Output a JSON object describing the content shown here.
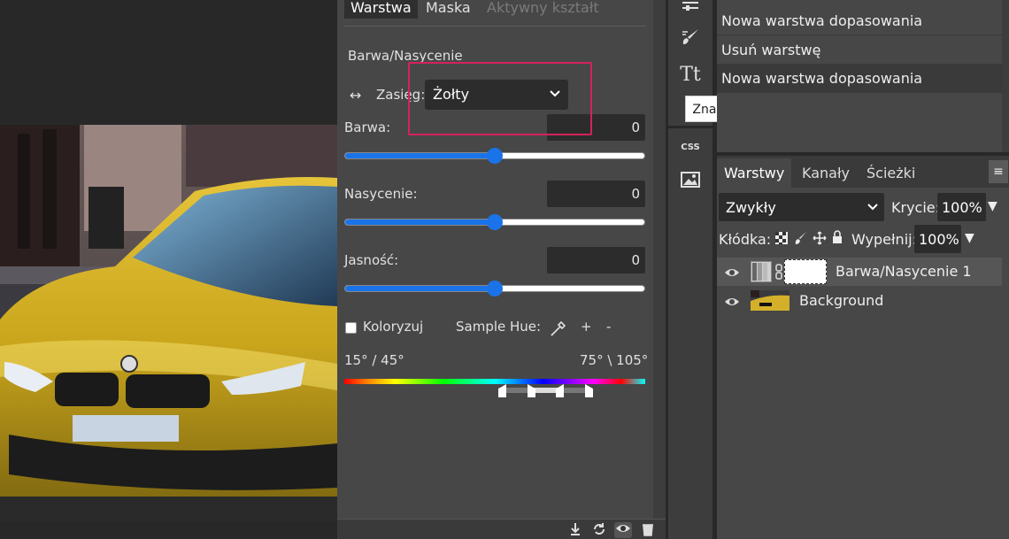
{
  "properties": {
    "tabs": [
      {
        "label": "Warstwa",
        "state": "active"
      },
      {
        "label": "Maska",
        "state": "normal"
      },
      {
        "label": "Aktywny kształt",
        "state": "disabled"
      }
    ],
    "section_title": "Barwa/Nasycenie",
    "range_label": "Zasięg:",
    "range_value": "Żołty",
    "hue": {
      "label": "Barwa:",
      "value": "0",
      "fraction": 0.5
    },
    "saturation": {
      "label": "Nasycenie:",
      "value": "0",
      "fraction": 0.5
    },
    "lightness": {
      "label": "Jasność:",
      "value": "0",
      "fraction": 0.5
    },
    "colorize_label": "Koloryzuj",
    "colorize_checked": false,
    "sample_hue_label": "Sample Hue:",
    "plus": "+",
    "minus": "-",
    "range_left": "15° / 45°",
    "range_right": "75° \\ 105°",
    "highlight_color": "#d6225c",
    "slider_color": "#1a73e8"
  },
  "tools": {
    "items": [
      "adjust-icon",
      "brush-icon",
      "text-icon",
      "css-icon",
      "image-icon"
    ],
    "css_label": "CSS",
    "text_glyph": "Tt",
    "tooltip": "Znak"
  },
  "history": {
    "items": [
      {
        "label": "Nowa warstwa dopasowania",
        "selected": false
      },
      {
        "label": "Usuń warstwę",
        "selected": false
      },
      {
        "label": "Nowa warstwa dopasowania",
        "selected": true
      }
    ]
  },
  "layers_panel": {
    "tabs": [
      "Warstwy",
      "Kanały",
      "Ścieżki"
    ],
    "active_tab": "Warstwy",
    "menu_glyph": "≡",
    "blend_mode": "Zwykły",
    "opacity_label": "Krycie:",
    "opacity_value": "100%",
    "lock_label": "Kłódka:",
    "fill_label": "Wypełnij:",
    "fill_value": "100%",
    "layers": [
      {
        "name": "Barwa/Nasycenie 1",
        "visible": true,
        "selected": true
      },
      {
        "name": "Background",
        "visible": true,
        "selected": false
      }
    ]
  }
}
